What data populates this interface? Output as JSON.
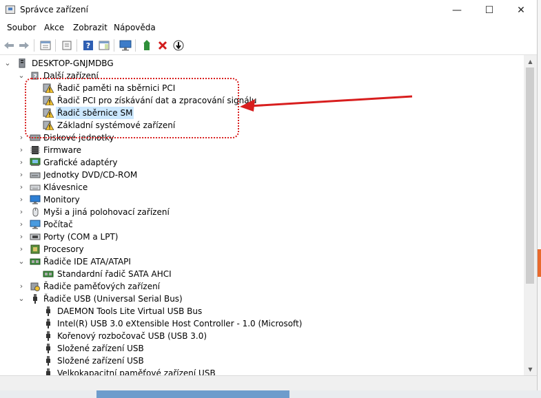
{
  "window": {
    "title": "Správce zařízení",
    "min_glyph": "—",
    "max_glyph": "☐",
    "close_glyph": "✕"
  },
  "menu": [
    "Soubor",
    "Akce",
    "Zobrazit",
    "Nápověda"
  ],
  "toolbar": [
    "back-icon",
    "forward-icon",
    "properties-icon",
    "show-hidden-icon",
    "help-icon",
    "action-panel-icon",
    "scan-hardware-icon",
    "update-driver-icon",
    "uninstall-icon",
    "disable-icon"
  ],
  "tree": {
    "root": "DESKTOP-GNJMDBG",
    "other_devices": {
      "label": "Další zařízení",
      "children": [
        "Řadič paměti na sběrnici PCI",
        "Řadič PCI pro získávání dat a zpracování signálu",
        "Řadič sběrnice SM",
        "Základní systémové zařízení"
      ]
    },
    "categories": [
      "Diskové jednotky",
      "Firmware",
      "Grafické adaptéry",
      "Jednotky DVD/CD-ROM",
      "Klávesnice",
      "Monitory",
      "Myši a jiná polohovací zařízení",
      "Počítač",
      "Porty (COM a LPT)",
      "Procesory"
    ],
    "ide": {
      "label": "Řadiče IDE ATA/ATAPI",
      "children": [
        "Standardní řadič  SATA AHCI"
      ]
    },
    "storage": {
      "label": "Řadiče paměťových zařízení"
    },
    "usb": {
      "label": "Řadiče USB (Universal Serial Bus)",
      "children": [
        "DAEMON Tools Lite Virtual USB Bus",
        "Intel(R) USB 3.0 eXtensible Host Controller - 1.0 (Microsoft)",
        "Kořenový rozbočovač USB (USB 3.0)",
        "Složené zařízení USB",
        "Složené zařízení USB",
        "Velkokapacitní paměťové zařízení USB"
      ]
    }
  },
  "colors": {
    "selection": "#cce8ff",
    "annotation": "#d81e1e",
    "warning": "#f2c230"
  }
}
